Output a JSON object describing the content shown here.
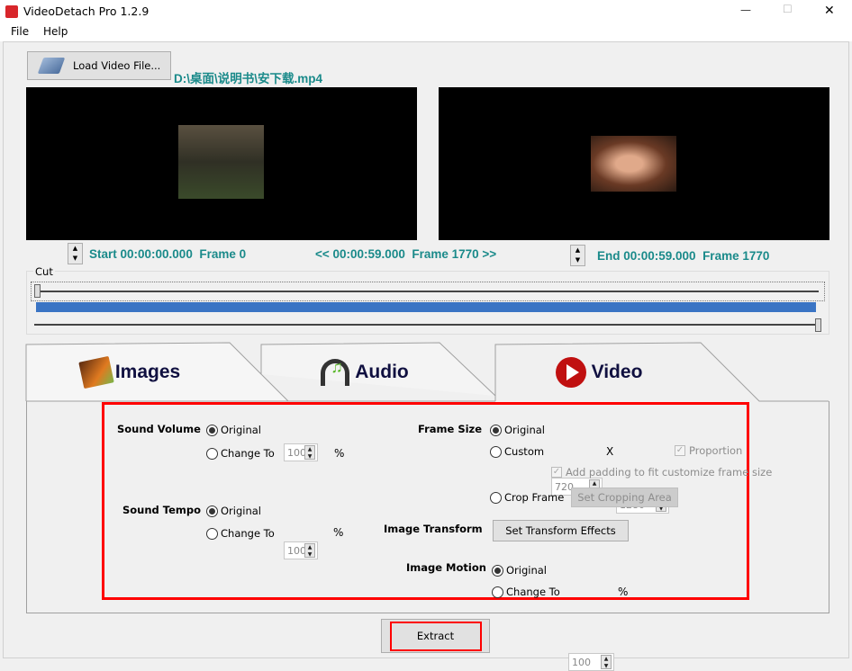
{
  "window": {
    "title": "VideoDetach Pro 1.2.9",
    "minimize": "—",
    "maximize": "☐",
    "close": "✕",
    "icon": "app-logo-icon"
  },
  "menu": [
    "File",
    "Help"
  ],
  "load_button": "Load Video File...",
  "file_path": "D:\\桌面\\说明书\\安下载.mp4",
  "timeline": {
    "start": "Start 00:00:00.000  Frame 0",
    "current": "<< 00:00:59.000  Frame 1770 >>",
    "end": "End 00:00:59.000  Frame 1770"
  },
  "cut": {
    "label": "Cut",
    "start_position": 0,
    "end_position": 1
  },
  "tabs": [
    {
      "label": "Images",
      "icon": "images-icon"
    },
    {
      "label": "Audio",
      "icon": "headphones-icon"
    },
    {
      "label": "Video",
      "icon": "play-icon",
      "active": true
    }
  ],
  "sound_volume": {
    "label": "Sound Volume",
    "original": "Original",
    "change": "Change To",
    "value": "100",
    "unit": "%",
    "selected": "Original"
  },
  "sound_tempo": {
    "label": "Sound Tempo",
    "original": "Original",
    "change": "Change To",
    "value": "100",
    "unit": "%",
    "selected": "Original"
  },
  "frame_size": {
    "label": "Frame Size",
    "original": "Original",
    "custom": "Custom",
    "width": "720",
    "x": "X",
    "height": "1280",
    "proportion": "Proportion",
    "padding": "Add padding to fit customize frame size",
    "crop": "Crop Frame",
    "crop_button": "Set Cropping Area",
    "selected": "Original"
  },
  "image_transform": {
    "label": "Image Transform",
    "button": "Set Transform Effects"
  },
  "image_motion": {
    "label": "Image Motion",
    "original": "Original",
    "change": "Change To",
    "value": "100",
    "unit": "%",
    "selected": "Original"
  },
  "extract_button": "Extract",
  "colors": {
    "accent_text": "#1a8a8a",
    "highlight": "#ff0000",
    "progress": "#3a74c4"
  }
}
